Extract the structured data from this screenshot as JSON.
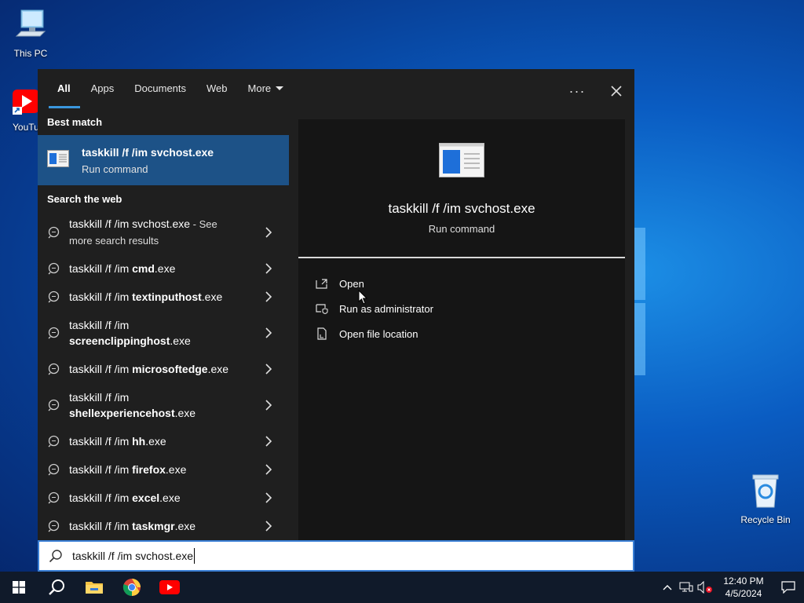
{
  "desktop": {
    "icons": [
      {
        "label": "This PC"
      },
      {
        "label": "YouTube"
      },
      {
        "label": "Recycle Bin"
      }
    ]
  },
  "search": {
    "tabs": [
      {
        "label": "All"
      },
      {
        "label": "Apps"
      },
      {
        "label": "Documents"
      },
      {
        "label": "Web"
      },
      {
        "label": "More"
      }
    ],
    "more_icon": "ellipsis-icon",
    "best_match_title": "Best match",
    "best_match": {
      "title": "taskkill /f /im svchost.exe",
      "subtitle": "Run command"
    },
    "web_title": "Search the web",
    "web_results": [
      {
        "prefix": "taskkill /f /im svchost.exe",
        "bold": "",
        "suffix": "",
        "extra": " - See more search results"
      },
      {
        "prefix": "taskkill /f /im ",
        "bold": "cmd",
        "suffix": ".exe",
        "extra": ""
      },
      {
        "prefix": "taskkill /f /im ",
        "bold": "textinputhost",
        "suffix": ".exe",
        "extra": ""
      },
      {
        "prefix": "taskkill /f /im ",
        "bold": "screenclippinghost",
        "suffix": ".exe",
        "extra": ""
      },
      {
        "prefix": "taskkill /f /im ",
        "bold": "microsoftedge",
        "suffix": ".exe",
        "extra": ""
      },
      {
        "prefix": "taskkill /f /im ",
        "bold": "shellexperiencehost",
        "suffix": ".exe",
        "extra": ""
      },
      {
        "prefix": "taskkill /f /im ",
        "bold": "hh",
        "suffix": ".exe",
        "extra": ""
      },
      {
        "prefix": "taskkill /f /im ",
        "bold": "firefox",
        "suffix": ".exe",
        "extra": ""
      },
      {
        "prefix": "taskkill /f /im ",
        "bold": "excel",
        "suffix": ".exe",
        "extra": ""
      },
      {
        "prefix": "taskkill /f /im ",
        "bold": "taskmgr",
        "suffix": ".exe",
        "extra": ""
      }
    ],
    "preview": {
      "title": "taskkill /f /im svchost.exe",
      "subtitle": "Run command",
      "actions": [
        {
          "label": "Open",
          "icon": "open-icon"
        },
        {
          "label": "Run as administrator",
          "icon": "shield-icon"
        },
        {
          "label": "Open file location",
          "icon": "file-location-icon"
        }
      ]
    },
    "input_value": "taskkill /f /im svchost.exe"
  },
  "taskbar": {
    "time": "12:40 PM",
    "date": "4/5/2024"
  },
  "colors": {
    "accent": "#3a96dd",
    "selected": "#1d5287",
    "panel": "#1f1f1f"
  }
}
